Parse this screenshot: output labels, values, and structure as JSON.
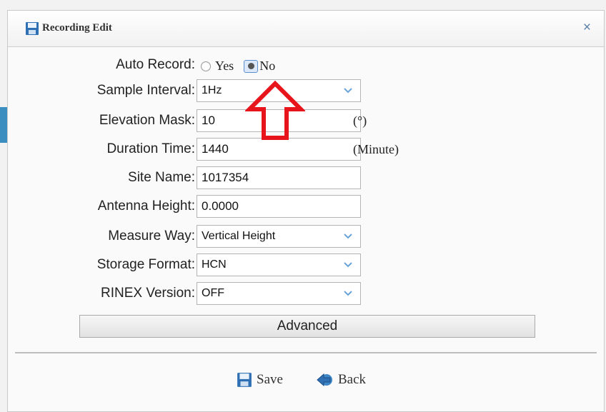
{
  "dialog": {
    "title": "Recording Edit",
    "title_icon": "floppy-disk-icon",
    "close_icon": "close-icon",
    "close_glyph": "×"
  },
  "form": {
    "auto_record": {
      "label": "Auto Record:",
      "options": [
        {
          "label": "Yes",
          "checked": false
        },
        {
          "label": "No",
          "checked": true
        }
      ]
    },
    "sample_interval": {
      "label": "Sample Interval:",
      "value": "1Hz"
    },
    "elevation_mask": {
      "label": "Elevation Mask:",
      "value": "10",
      "unit": "(°)"
    },
    "duration_time": {
      "label": "Duration Time:",
      "value": "1440",
      "unit": "(Minute)"
    },
    "site_name": {
      "label": "Site Name:",
      "value": "1017354"
    },
    "antenna_height": {
      "label": "Antenna Height:",
      "value": "0.0000"
    },
    "measure_way": {
      "label": "Measure Way:",
      "value": "Vertical Height"
    },
    "storage_format": {
      "label": "Storage Format:",
      "value": "HCN"
    },
    "rinex_version": {
      "label": "RINEX Version:",
      "value": "OFF"
    },
    "advanced_label": "Advanced"
  },
  "footer": {
    "save_label": "Save",
    "save_icon": "floppy-disk-icon",
    "back_label": "Back",
    "back_icon": "back-arrow-icon"
  },
  "colors": {
    "annotation_arrow": "#e8141c",
    "close_icon": "#5b7fa8",
    "chevron": "#6aa3d8"
  }
}
